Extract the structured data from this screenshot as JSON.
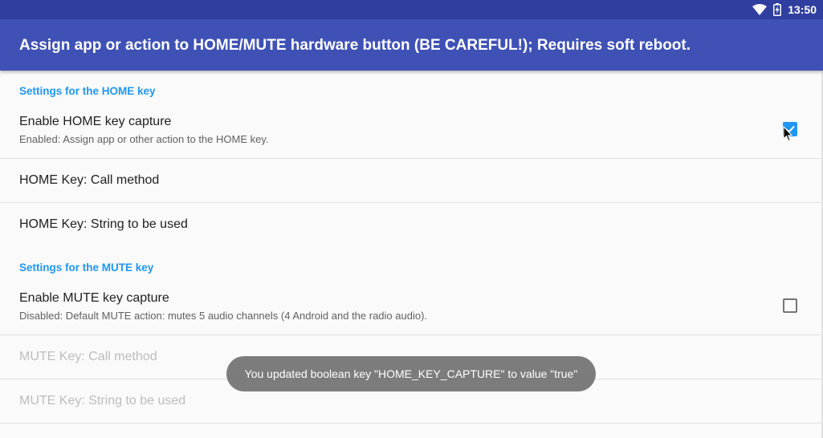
{
  "statusbar": {
    "time": "13:50",
    "icons": [
      "wifi-icon",
      "battery-charging-icon"
    ]
  },
  "appbar": {
    "title": "Assign app or action to HOME/MUTE hardware button (BE CAREFUL!); Requires soft reboot."
  },
  "sections": [
    {
      "category": "Settings for the HOME key",
      "prefs": [
        {
          "title": "Enable HOME key capture",
          "summary": "Enabled: Assign app or other action to the HOME key.",
          "checked": true
        },
        {
          "title": "HOME Key: Call method"
        },
        {
          "title": "HOME Key: String to be used"
        }
      ]
    },
    {
      "category": "Settings for the MUTE key",
      "prefs": [
        {
          "title": "Enable MUTE key capture",
          "summary": "Disabled: Default MUTE action: mutes 5 audio channels (4 Android and the radio audio).",
          "checked": false
        },
        {
          "title": "MUTE Key: Call method",
          "disabled": true
        },
        {
          "title": "MUTE Key: String to be used",
          "disabled": true
        }
      ]
    }
  ],
  "toast": {
    "message": "You updated boolean key \"HOME_KEY_CAPTURE\" to value \"true\""
  },
  "colors": {
    "statusbar": "#303f9f",
    "appbar": "#3f51b5",
    "accent": "#2196f3"
  }
}
